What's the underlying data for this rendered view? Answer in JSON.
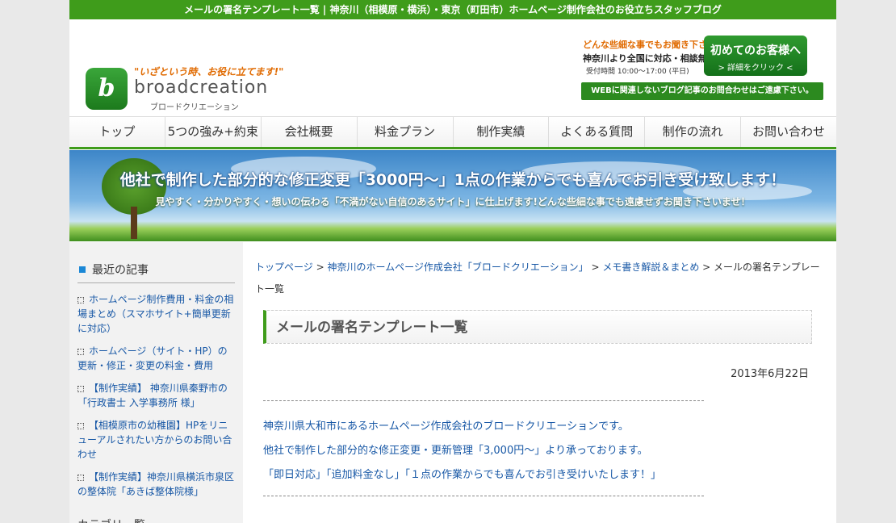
{
  "topbar": {
    "text": "メールの署名テンプレート一覧 | 神奈川（相模原・横浜）・東京（町田市）ホームページ制作会社のお役立ちスタッフブログ"
  },
  "logo": {
    "tagline": "\"いざという時、お役に立てます!\"",
    "name": "broadcreation",
    "kana": "ブロードクリエーション",
    "mark": "b"
  },
  "contact": {
    "line1": "どんな些細な事でもお聞き下さい!",
    "line2": "神奈川より全国に対応・相談無料!",
    "hours": "受付時間  10:00〜17:00 (平日)",
    "first_btn_title": "初めてのお客様へ",
    "first_btn_sub": "> 詳細をクリック <",
    "web_note": "WEBに関連しないブログ記事のお問合わせはご遠慮下さい。"
  },
  "nav": {
    "items": [
      {
        "label": "トップ"
      },
      {
        "label": "5つの強み+約束"
      },
      {
        "label": "会社概要"
      },
      {
        "label": "料金プラン"
      },
      {
        "label": "制作実績"
      },
      {
        "label": "よくある質問"
      },
      {
        "label": "制作の流れ"
      },
      {
        "label": "お問い合わせ"
      }
    ]
  },
  "banner": {
    "headline": "他社で制作した部分的な修正変更「3000円〜」1点の作業からでも喜んでお引き受け致します！",
    "sub": "見やすく・分かりやすく・想いの伝わる「不満がない自信のあるサイト」に仕上げます!どんな些細な事でも遠慮せずお聞き下さいませ！"
  },
  "sidebar": {
    "heading": "最近の記事",
    "items": [
      {
        "text": "ホームページ制作費用・料金の相場まとめ（スマホサイト+簡単更新に対応）"
      },
      {
        "text": "ホームページ（サイト・HP）の更新・修正・変更の料金・費用"
      },
      {
        "text": "【制作実績】 神奈川県秦野市の「行政書士 入学事務所 様」"
      },
      {
        "text": "【相模原市の幼稚園】HPをリニューアルされたい方からのお問い合わせ"
      },
      {
        "text": "【制作実績】神奈川県横浜市泉区の整体院「あきば整体院様」"
      }
    ],
    "heading2": "カテゴリ一覧"
  },
  "content": {
    "breadcrumb": {
      "home": "トップページ",
      "sep": " > ",
      "company": "神奈川のホームページ作成会社「ブロードクリエーション」",
      "category": "メモ書き解説＆まとめ",
      "current": "メールの署名テンプレート一覧"
    },
    "title": "メールの署名テンプレート一覧",
    "date": "2013年6月22日",
    "paragraphs": [
      "神奈川県大和市にあるホームページ作成会社のブロードクリエーションです。",
      "他社で制作した部分的な修正変更・更新管理「3,000円〜」より承っております。",
      "「即日対応」「追加料金なし」「１点の作業からでも喜んでお引き受けいたします！」"
    ]
  }
}
